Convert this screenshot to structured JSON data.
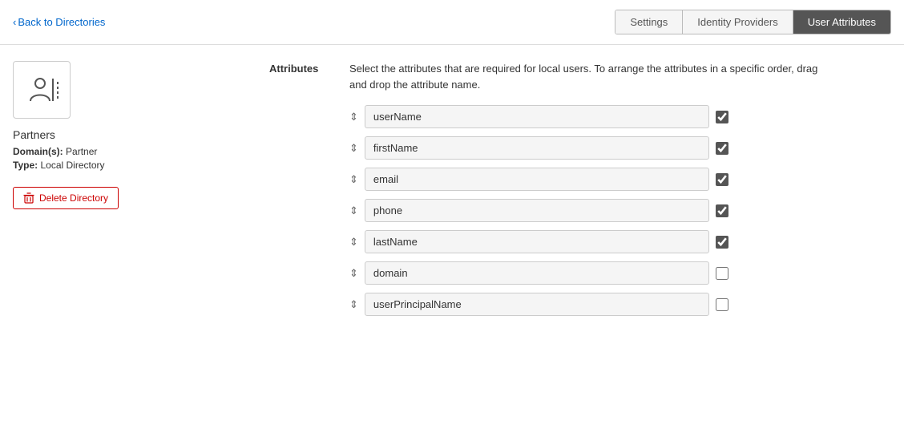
{
  "header": {
    "back_label": "Back to Directories",
    "tabs": [
      {
        "id": "settings",
        "label": "Settings",
        "active": false
      },
      {
        "id": "identity-providers",
        "label": "Identity Providers",
        "active": false
      },
      {
        "id": "user-attributes",
        "label": "User Attributes",
        "active": true
      }
    ]
  },
  "sidebar": {
    "directory_name": "Partners",
    "domains_label": "Domain(s):",
    "domains_value": "Partner",
    "type_label": "Type:",
    "type_value": "Local Directory",
    "delete_label": "Delete Directory"
  },
  "attributes_section": {
    "label": "Attributes",
    "description": "Select the attributes that are required for local users. To arrange the attributes in a specific order, drag and drop the attribute name.",
    "items": [
      {
        "name": "userName",
        "checked": true,
        "checked_state": "checked"
      },
      {
        "name": "firstName",
        "checked": true,
        "checked_state": "checked"
      },
      {
        "name": "email",
        "checked": true,
        "checked_state": "checked"
      },
      {
        "name": "phone",
        "checked": true,
        "checked_state": "checked"
      },
      {
        "name": "lastName",
        "checked": true,
        "checked_state": "checked"
      },
      {
        "name": "domain",
        "checked": false,
        "checked_state": "unchecked"
      },
      {
        "name": "userPrincipalName",
        "checked": false,
        "checked_state": "unchecked"
      }
    ]
  }
}
